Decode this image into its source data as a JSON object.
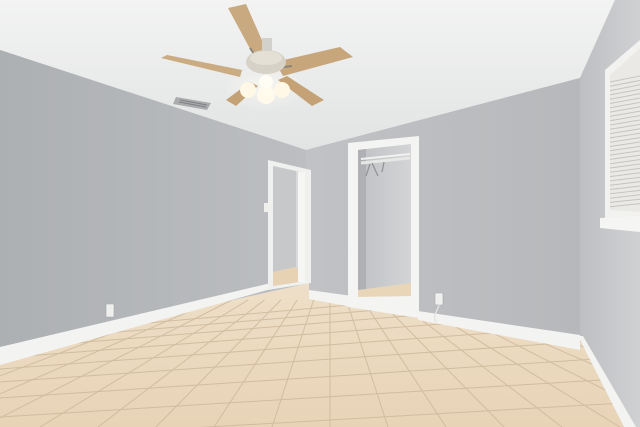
{
  "scene": {
    "subject": "empty-bedroom-interior",
    "palette": {
      "ceiling": "#eceeed",
      "wall_left": "#b7b9bc",
      "wall_back": "#bcbec1",
      "wall_right": "#c3c5c8",
      "baseboard": "#f3f3f1",
      "floor_tile": "#ead7bd",
      "grout": "#c8b394",
      "door_frame": "#f4f4f2",
      "closet_interior": "#c9cbce",
      "fan_blade": "#c9a97f",
      "fan_light": "#fff6df"
    },
    "icons": [
      "ceiling-fan-icon",
      "air-vent-icon",
      "outlet-icon",
      "light-switch-icon",
      "window-blinds-icon"
    ]
  }
}
